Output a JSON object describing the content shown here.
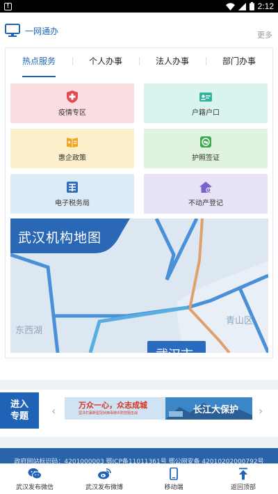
{
  "status_bar": {
    "time": "2:12",
    "icons": [
      "alert-icon",
      "wifi-icon",
      "signal-icon",
      "battery-icon"
    ]
  },
  "section": {
    "title": "一网通办",
    "more": "更多",
    "icon": "monitor-icon"
  },
  "tabs": [
    {
      "label": "热点服务",
      "active": true
    },
    {
      "label": "个人办事",
      "active": false
    },
    {
      "label": "法人办事",
      "active": false
    },
    {
      "label": "部门办事",
      "active": false
    }
  ],
  "services": [
    {
      "label": "疫情专区",
      "icon": "shield-cross-icon"
    },
    {
      "label": "户籍户口",
      "icon": "id-card-icon"
    },
    {
      "label": "惠企政策",
      "icon": "book-icon"
    },
    {
      "label": "护照签证",
      "icon": "passport-icon"
    },
    {
      "label": "电子税务局",
      "icon": "tax-icon"
    },
    {
      "label": "不动产登记",
      "icon": "house-icon"
    }
  ],
  "map": {
    "title": "武汉机构地图",
    "places": [
      "东西湖",
      "青山区",
      "武汉市"
    ]
  },
  "topic": {
    "label_line1": "进入",
    "label_line2": "专题",
    "banner_left": "万众一心，众志成城",
    "banner_sub": "坚决打赢新型冠状病毒肺炎防控阻击战",
    "banner_right": "长江大保护"
  },
  "footer": {
    "text": "政府网站标识码：4201000003 鄂ICP备11011361号 鄂公网安备 42010202000792号"
  },
  "bottom_nav": [
    {
      "label": "武汉发布微信",
      "icon": "wechat-icon"
    },
    {
      "label": "武汉发布微博",
      "icon": "weibo-icon"
    },
    {
      "label": "移动端",
      "icon": "mobile-icon"
    },
    {
      "label": "返回顶部",
      "icon": "back-to-top-icon"
    }
  ],
  "colors": {
    "primary": "#1f63b6",
    "footer": "#2a63a8",
    "pink": "#fadde0",
    "mint": "#d9f4ee",
    "yellow": "#fcefc9",
    "green": "#e0f3df",
    "blue": "#dcebf8",
    "purple": "#e8e2f6"
  }
}
